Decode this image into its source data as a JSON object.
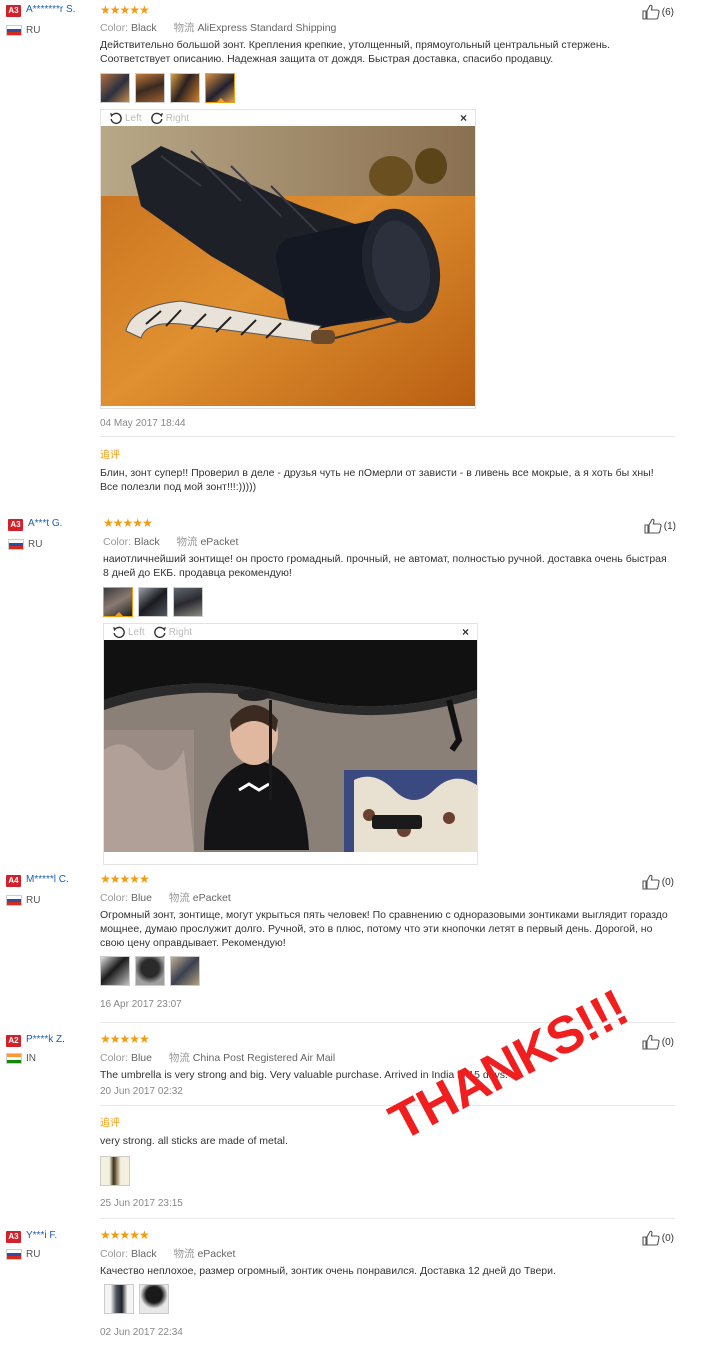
{
  "labels": {
    "color": "Color:",
    "shipping": "物流",
    "left": "Left",
    "right": "Right",
    "followup": "追评",
    "close": "×"
  },
  "reviews": [
    {
      "level": "A3",
      "user": "A*******r S.",
      "country": "RU",
      "helpful": "(6)",
      "color": "Black",
      "shipping": "AliExpress Standard Shipping",
      "text": "Действительно большой зонт. Крепления крепкие, утолщенный, прямоугольный центральный стержень. Соответствует описанию. Надежная защита от дождя. Быстрая доставка, спасибо продавцу.",
      "date": "04 May 2017 18:44",
      "followup_text": "Блин, зонт супер!! Проверил в деле - друзья чуть не пОмерли от зависти - в ливень все мокрые, а я хоть бы хны! Все полезли под мой зонт!!!:)))))"
    },
    {
      "level": "A3",
      "user": "A***t G.",
      "country": "RU",
      "helpful": "(1)",
      "color": "Black",
      "shipping": "ePacket",
      "text": "наиотличнейший зонтище! он просто громадный. прочный, не автомат, полностью ручной. доставка очень быстрая 8 дней до ЕКБ. продавца рекомендую!"
    },
    {
      "level": "A4",
      "user": "M*****l C.",
      "country": "RU",
      "helpful": "(0)",
      "color": "Blue",
      "shipping": "ePacket",
      "text": "Огромный зонт, зонтище, могут укрыться пять человек! По сравнению с одноразовыми зонтиками выглядит гораздо мощнее, думаю прослужит долго. Ручной, это в плюс, потому что эти кнопочки летят в первый день. Дорогой, но свою цену оправдывает. Рекомендую!",
      "date": "16 Apr 2017 23:07"
    },
    {
      "level": "A2",
      "user": "P****k Z.",
      "country": "IN",
      "helpful": "(0)",
      "color": "Blue",
      "shipping": "China Post Registered Air Mail",
      "text": "The umbrella is very strong and big. Very valuable purchase. Arrived in India in 15 days.",
      "date": "20 Jun 2017 02:32",
      "followup_text": "very strong. all sticks are made of metal.",
      "followup_date": "25 Jun 2017 23:15"
    },
    {
      "level": "A3",
      "user": "Y***i F.",
      "country": "RU",
      "helpful": "(0)",
      "color": "Black",
      "shipping": "ePacket",
      "text": "Качество неплохое, размер огромный, зонтик очень понравился. Доставка 12 дней до Твери.",
      "date": "02 Jun 2017 22:34"
    }
  ],
  "overlay": {
    "text": "THANKS!!!"
  },
  "colors": {
    "accent": "#f29c11",
    "badge": "#d4202a",
    "link": "#1a5fb4",
    "overlay": "#f01e1e"
  }
}
